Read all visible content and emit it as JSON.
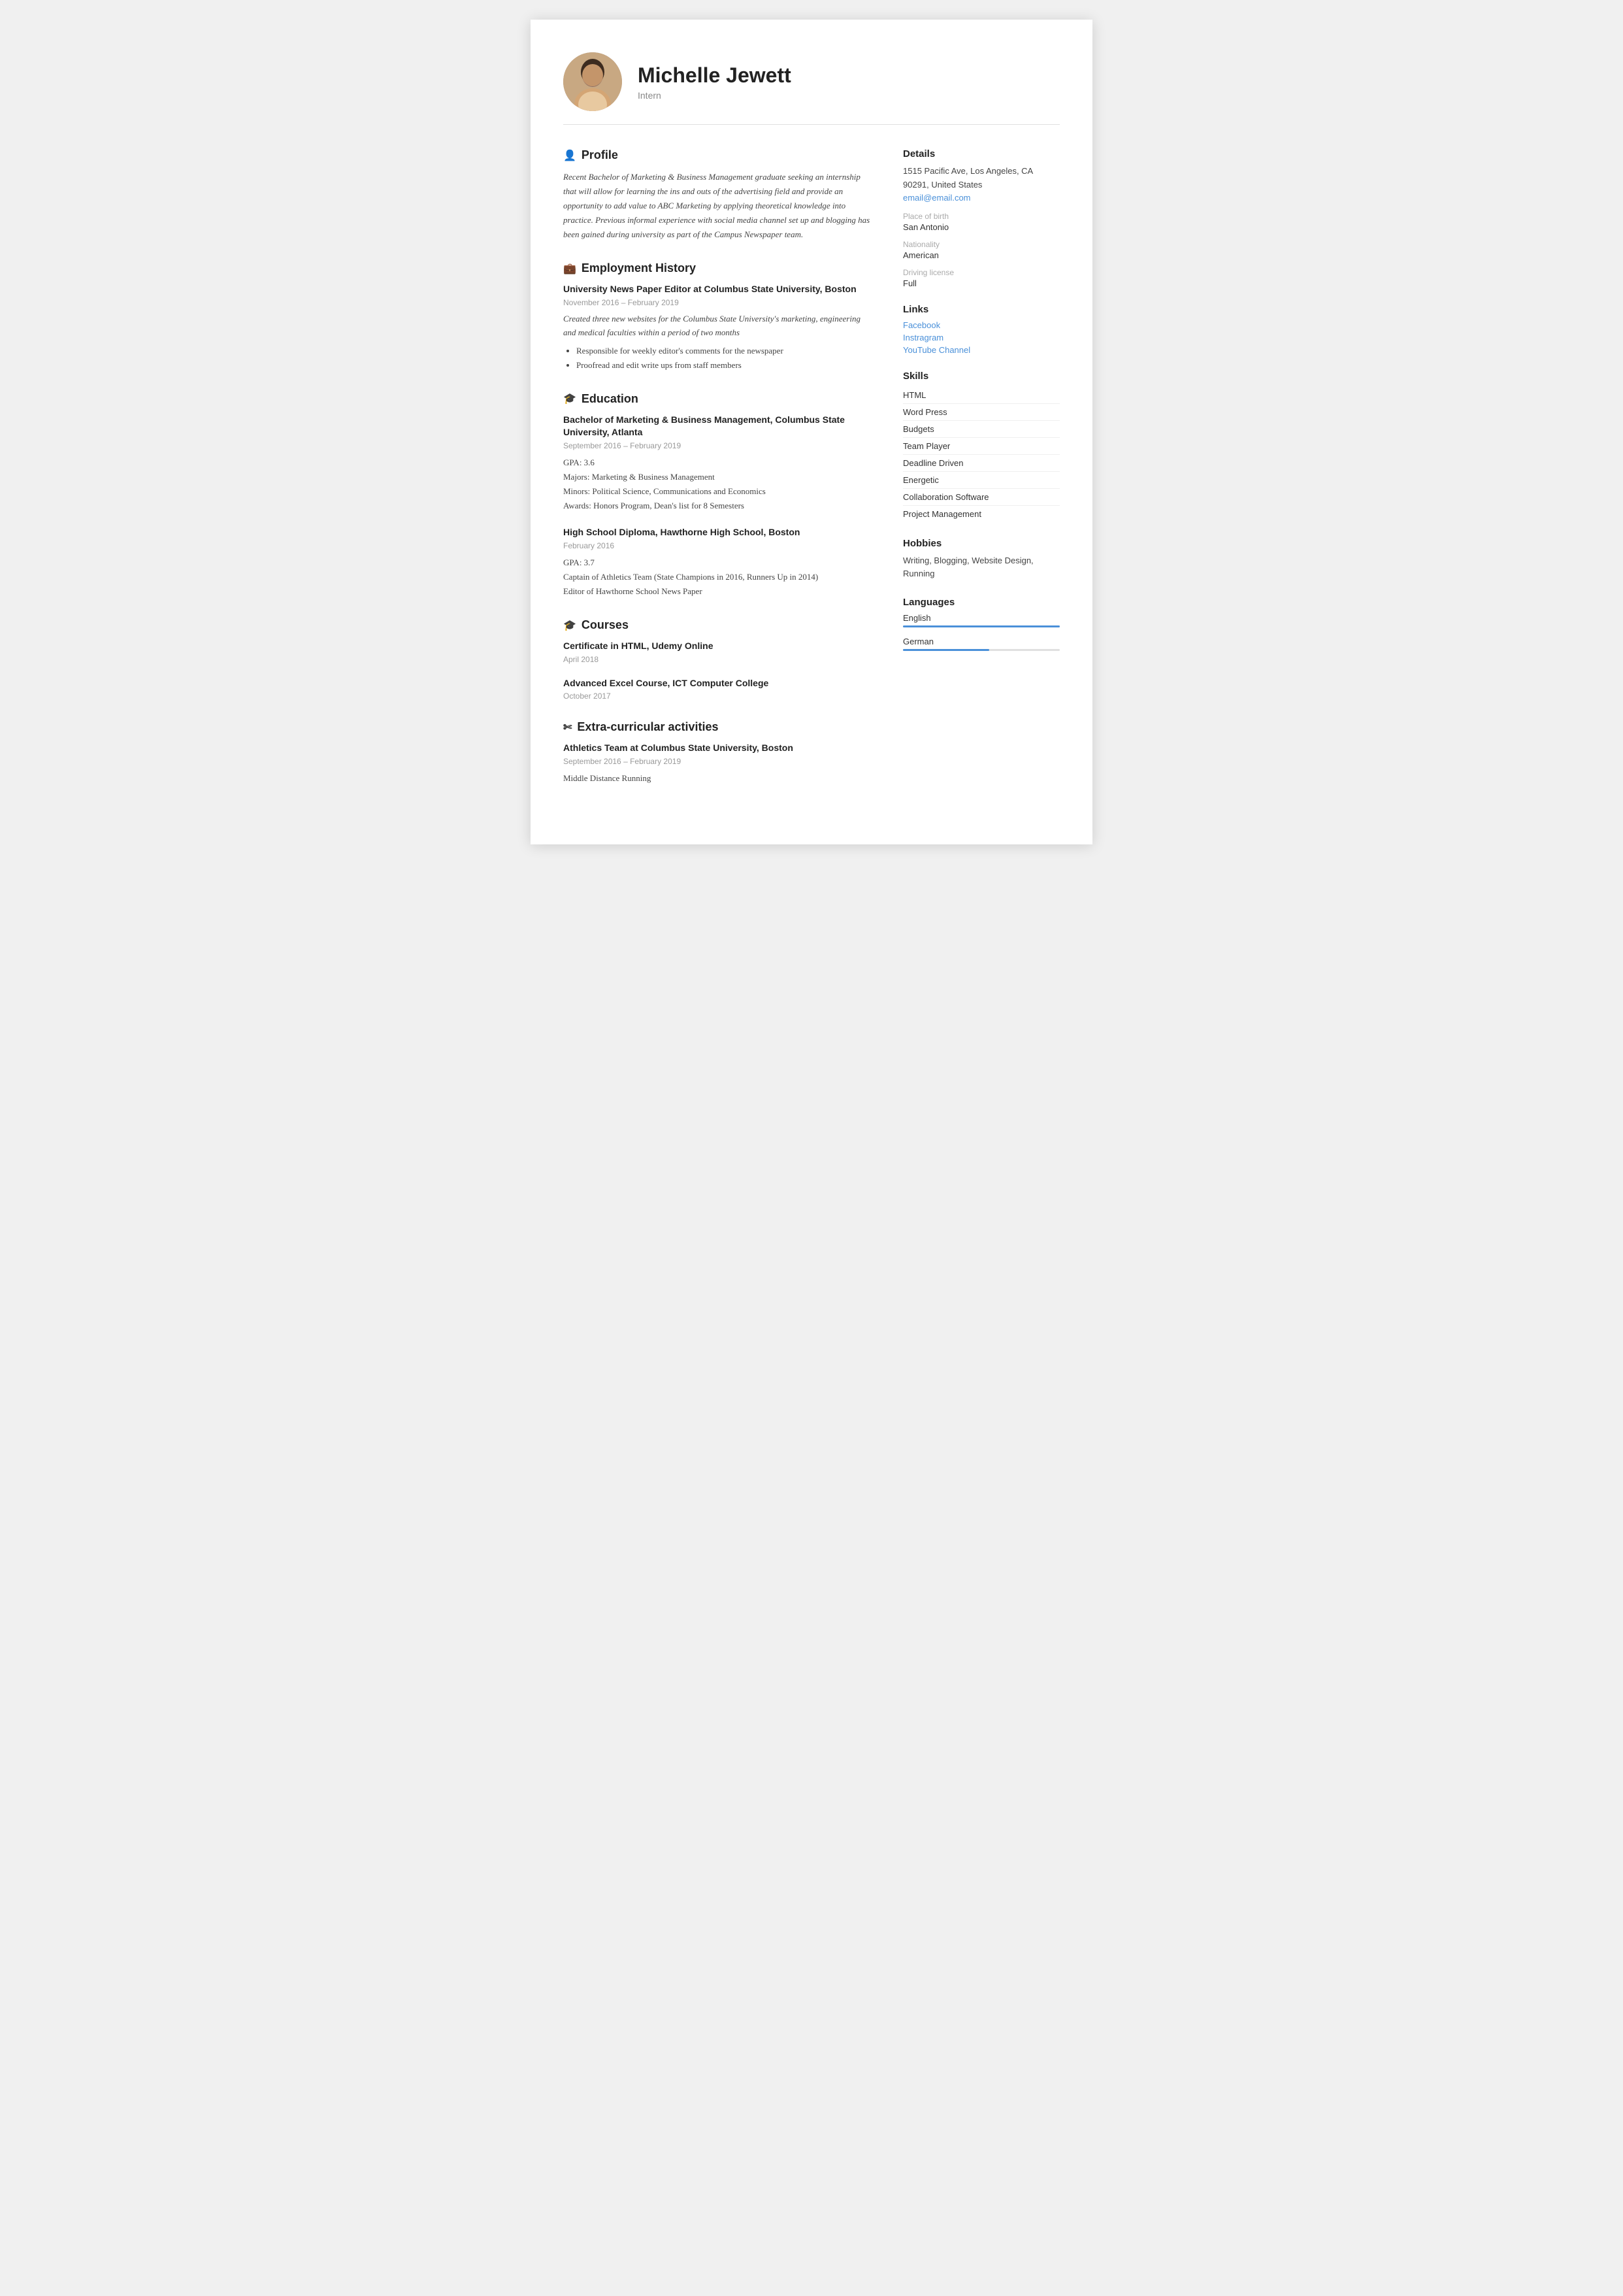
{
  "header": {
    "name": "Michelle Jewett",
    "title": "Intern",
    "avatar_alt": "Michelle Jewett photo"
  },
  "profile": {
    "section_title": "Profile",
    "icon": "👤",
    "text": "Recent Bachelor of Marketing & Business Management graduate seeking an internship that will allow for learning the ins and outs of the advertising field and provide an opportunity to add value to ABC Marketing by applying theoretical knowledge into practice. Previous informal experience with social media channel set up and blogging has been gained during university as part of the Campus Newspaper team."
  },
  "employment": {
    "section_title": "Employment History",
    "icon": "💼",
    "entries": [
      {
        "title": "University News Paper Editor at Columbus State University, Boston",
        "dates": "November 2016 – February 2019",
        "description": "Created three new websites for the Columbus State University's marketing, engineering and medical faculties within a period of two months",
        "bullets": [
          "Responsible for weekly editor's comments for the newspaper",
          "Proofread and edit write ups from staff members"
        ]
      }
    ]
  },
  "education": {
    "section_title": "Education",
    "icon": "🎓",
    "entries": [
      {
        "title": "Bachelor of Marketing & Business Management, Columbus State University, Atlanta",
        "dates": "September 2016 – February 2019",
        "details": [
          "GPA: 3.6",
          "Majors: Marketing & Business Management",
          "Minors: Political Science, Communications and Economics",
          "Awards: Honors Program, Dean's list for 8 Semesters"
        ]
      },
      {
        "title": "High School Diploma, Hawthorne High School, Boston",
        "dates": "February 2016",
        "details": [
          "GPA: 3.7",
          "Captain of Athletics Team (State Champions in 2016, Runners Up in 2014)",
          "Editor of Hawthorne School News Paper"
        ]
      }
    ]
  },
  "courses": {
    "section_title": "Courses",
    "icon": "🎓",
    "entries": [
      {
        "title": "Certificate in HTML, Udemy Online",
        "dates": "April 2018"
      },
      {
        "title": "Advanced Excel Course, ICT Computer College",
        "dates": "October 2017"
      }
    ]
  },
  "extracurricular": {
    "section_title": "Extra-curricular activities",
    "icon": "✂",
    "entries": [
      {
        "title": "Athletics Team at Columbus State University, Boston",
        "dates": "September 2016 – February 2019",
        "details": [
          "Middle Distance Running"
        ]
      }
    ]
  },
  "details": {
    "section_title": "Details",
    "address": "1515 Pacific Ave, Los Angeles, CA 90291, United States",
    "email": "email@email.com",
    "place_of_birth_label": "Place of birth",
    "place_of_birth": "San Antonio",
    "nationality_label": "Nationality",
    "nationality": "American",
    "driving_license_label": "Driving license",
    "driving_license": "Full"
  },
  "links": {
    "section_title": "Links",
    "items": [
      {
        "label": "Facebook",
        "url": "#"
      },
      {
        "label": "Instragram",
        "url": "#"
      },
      {
        "label": "YouTube Channel",
        "url": "#"
      }
    ]
  },
  "skills": {
    "section_title": "Skills",
    "items": [
      "HTML",
      "Word Press",
      "Budgets",
      "Team Player",
      "Deadline Driven",
      "Energetic",
      "Collaboration Software",
      "Project Management"
    ]
  },
  "hobbies": {
    "section_title": "Hobbies",
    "text": "Writing, Blogging, Website Design, Running"
  },
  "languages": {
    "section_title": "Languages",
    "items": [
      {
        "name": "English",
        "level": 100
      },
      {
        "name": "German",
        "level": 55
      }
    ]
  }
}
